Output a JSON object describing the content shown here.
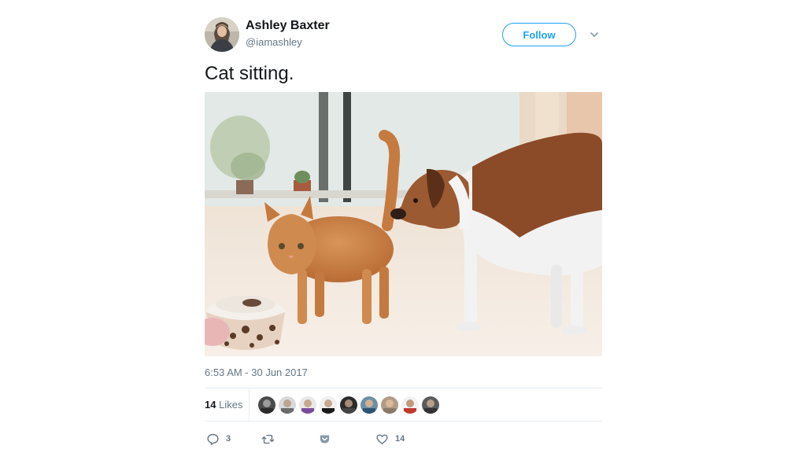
{
  "author": {
    "display_name": "Ashley Baxter",
    "handle": "@iamashley",
    "follow_label": "Follow"
  },
  "tweet": {
    "text": "Cat sitting.",
    "timestamp": "6:53 AM - 30 Jun 2017"
  },
  "likes": {
    "count": "14",
    "label": "Likes"
  },
  "actions": {
    "reply_count": "3",
    "retweet_count": "",
    "like_count": "14"
  },
  "colors": {
    "accent": "#1da1f2",
    "secondary_text": "#657786",
    "divider": "#e6ecf0"
  },
  "icons": {
    "reply": "reply-icon",
    "retweet": "retweet-icon",
    "save": "pocket-icon",
    "like": "heart-icon",
    "caret": "chevron-down-icon"
  }
}
